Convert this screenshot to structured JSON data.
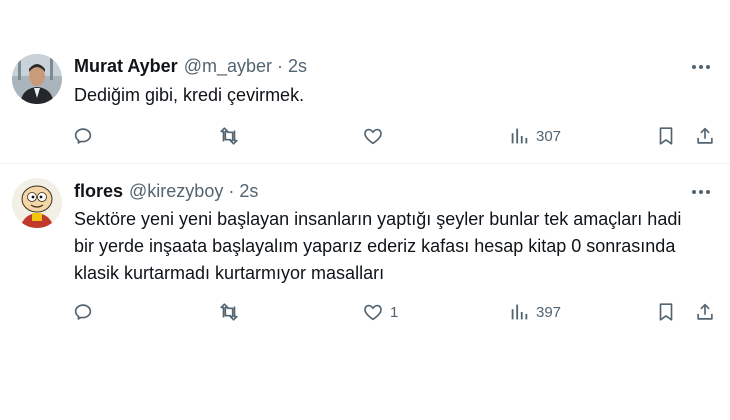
{
  "tweets": [
    {
      "name": "Murat Ayber",
      "handle": "@m_ayber",
      "dot": "·",
      "time": "2s",
      "lines": [
        "Dediğim gibi, kredi çevirmek."
      ],
      "actions": {
        "reply": "",
        "retweet": "",
        "like": "",
        "views": "307"
      },
      "avatar_icon": "person-photo"
    },
    {
      "name": "flores",
      "handle": "@kirezyboy",
      "dot": "·",
      "time": "2s",
      "lines": [
        "Sektöre yeni yeni başlayan insanların yaptığı şeyler bunlar tek amaçları hadi",
        "bir yerde inşaata başlayalım yaparız ederiz kafası hesap kitap 0 sonrasında",
        "klasik kurtarmadı kurtarmıyor masalları"
      ],
      "actions": {
        "reply": "",
        "retweet": "",
        "like": "1",
        "views": "397"
      },
      "avatar_icon": "cartoon-character"
    }
  ],
  "colors": {
    "text": "#0f1419",
    "muted": "#536471",
    "divider": "#eff3f4"
  }
}
